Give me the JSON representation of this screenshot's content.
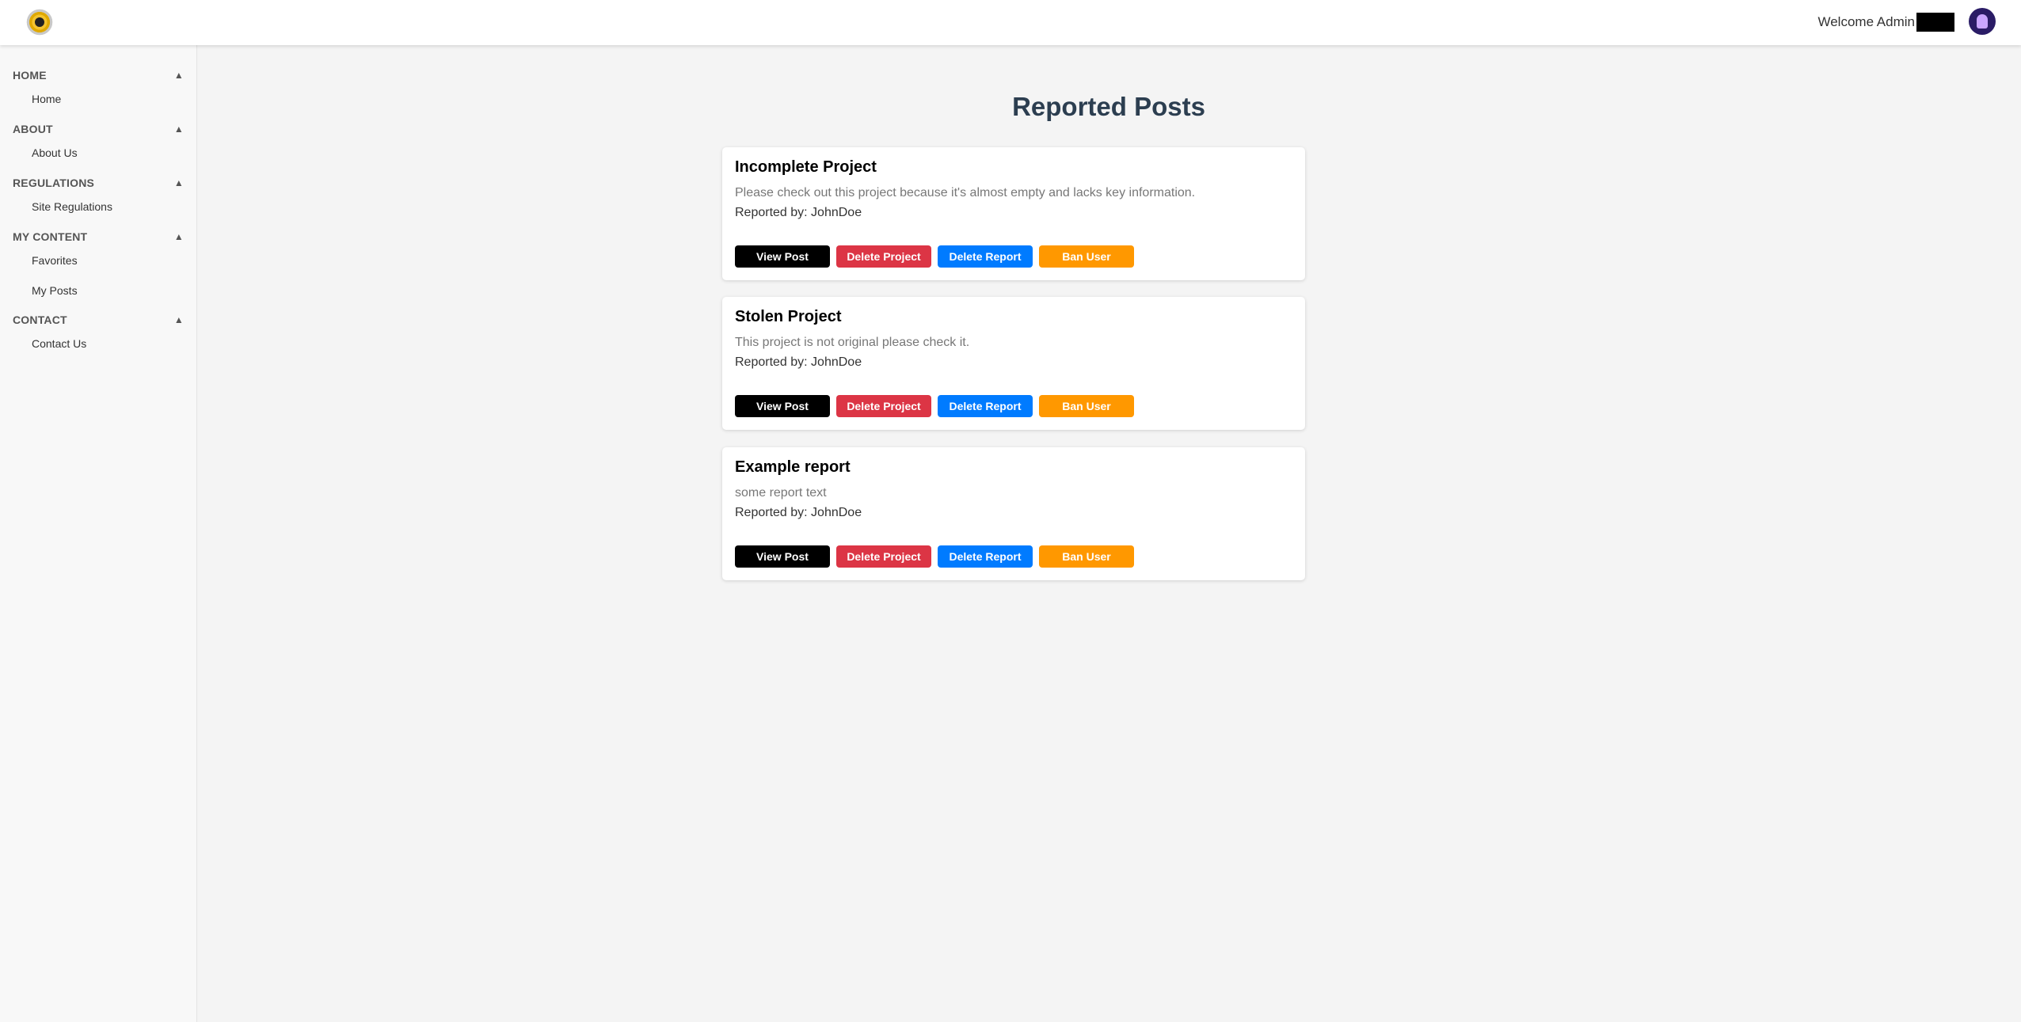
{
  "header": {
    "welcome_text": "Welcome Admin"
  },
  "sidebar": {
    "sections": [
      {
        "title": "HOME",
        "arrow": "▲",
        "items": [
          "Home"
        ]
      },
      {
        "title": "ABOUT",
        "arrow": "▲",
        "items": [
          "About Us"
        ]
      },
      {
        "title": "REGULATIONS",
        "arrow": "▲",
        "items": [
          "Site Regulations"
        ]
      },
      {
        "title": "MY CONTENT",
        "arrow": "▲",
        "items": [
          "Favorites",
          "My Posts"
        ]
      },
      {
        "title": "CONTACT",
        "arrow": "▲",
        "items": [
          "Contact Us"
        ]
      }
    ]
  },
  "main": {
    "title": "Reported Posts",
    "reports": [
      {
        "title": "Incomplete Project",
        "description": "Please check out this project because it's almost empty and lacks key information.",
        "reported_by": "Reported by: JohnDoe"
      },
      {
        "title": "Stolen Project",
        "description": "This project is not original please check it.",
        "reported_by": "Reported by: JohnDoe"
      },
      {
        "title": "Example report",
        "description": "some report text",
        "reported_by": "Reported by: JohnDoe"
      }
    ],
    "buttons": {
      "view_post": "View Post",
      "delete_project": "Delete Project",
      "delete_report": "Delete Report",
      "ban_user": "Ban User"
    }
  },
  "colors": {
    "view_post": "#000000",
    "delete_project": "#dc3545",
    "delete_report": "#007bff",
    "ban_user": "#ff9800",
    "title": "#2c3e50"
  }
}
